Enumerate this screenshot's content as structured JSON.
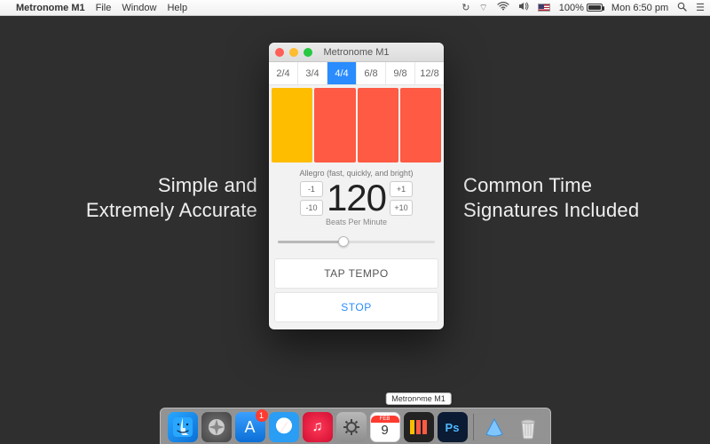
{
  "menubar": {
    "app_name": "Metronome M1",
    "items": [
      "File",
      "Window",
      "Help"
    ],
    "battery_pct": "100%",
    "clock": "Mon 6:50 pm"
  },
  "promo": {
    "left_line1": "Simple and",
    "left_line2": "Extremely Accurate",
    "right_line1": "Common Time",
    "right_line2": "Signatures Included"
  },
  "window": {
    "title": "Metronome M1",
    "time_signatures": [
      "2/4",
      "3/4",
      "4/4",
      "6/8",
      "9/8",
      "12/8"
    ],
    "active_sig_index": 2,
    "tempo_desc": "Allegro (fast, quickly, and bright)",
    "bpm": "120",
    "bpm_label": "Beats Per Minute",
    "step_minus1": "-1",
    "step_minus10": "-10",
    "step_plus1": "+1",
    "step_plus10": "+10",
    "tap_label": "TAP TEMPO",
    "stop_label": "STOP"
  },
  "dock": {
    "tooltip": "Metronome M1",
    "appstore_badge": "1",
    "cal_month": "FEB",
    "cal_day": "9",
    "ps_label": "Ps"
  }
}
